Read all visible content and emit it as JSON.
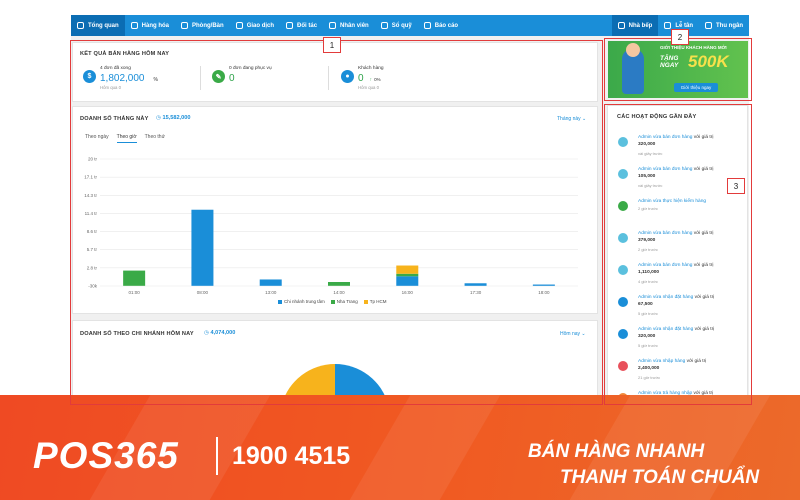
{
  "nav": {
    "left": [
      {
        "label": "Tổng quan",
        "icon": "eye-icon"
      },
      {
        "label": "Hàng hóa",
        "icon": "box-icon"
      },
      {
        "label": "Phòng/Bàn",
        "icon": "table-icon"
      },
      {
        "label": "Giao dịch",
        "icon": "exchange-icon"
      },
      {
        "label": "Đối tác",
        "icon": "handshake-icon"
      },
      {
        "label": "Nhân viên",
        "icon": "users-icon"
      },
      {
        "label": "Sổ quỹ",
        "icon": "coin-icon"
      },
      {
        "label": "Báo cáo",
        "icon": "chart-icon"
      }
    ],
    "right": [
      {
        "label": "Nhà bếp",
        "icon": "chef-hat-icon"
      },
      {
        "label": "Lễ tân",
        "icon": "calendar-icon"
      },
      {
        "label": "Thu ngân",
        "icon": "cashier-icon"
      }
    ]
  },
  "today": {
    "title": "KẾT QUẢ BÁN HÀNG HÔM NAY",
    "sold": {
      "label": "4 đơn đã xong",
      "value": "1,802,000",
      "suffix": "%",
      "sub": "Hôm qua 0"
    },
    "serving": {
      "label": "0 đơn đang phục vụ",
      "value": "0"
    },
    "customers": {
      "label": "Khách hàng",
      "value": "0",
      "change": "0%",
      "sub": "Hôm qua 0"
    }
  },
  "monthly": {
    "title": "DOANH SỐ THÁNG NÀY",
    "total": "15,582,000",
    "period": "Tháng này",
    "tabs": [
      "Theo ngày",
      "Theo giờ",
      "Theo thứ"
    ]
  },
  "chart_data": {
    "type": "bar",
    "categories": [
      "01:00",
      "08:00",
      "13:00",
      "14:00",
      "16:00",
      "17:30",
      "18:00"
    ],
    "series": [
      {
        "name": "Chi nhánh trung tâm",
        "color": "#1a8ed8",
        "values": [
          0,
          12.0,
          1.0,
          0,
          1.5,
          0.4,
          0.2
        ]
      },
      {
        "name": "Nha Trang",
        "color": "#3aaa47",
        "values": [
          2.4,
          0,
          0,
          0.6,
          0.4,
          0,
          0
        ]
      },
      {
        "name": "Tp HCM",
        "color": "#f7b31c",
        "values": [
          0,
          0,
          0,
          0,
          1.3,
          0,
          0
        ]
      }
    ],
    "yticks": [
      "20 tr",
      "17.1 tr",
      "14.3 tr",
      "11.4 tr",
      "8.6 tr",
      "5.7 tr",
      "2.8 tr",
      "-30k"
    ],
    "ylim": [
      -0.03,
      20
    ],
    "stacked": true
  },
  "branch": {
    "title": "DOANH SỐ THEO CHI NHÁNH HÔM NAY",
    "total": "4,074,000",
    "period": "Hôm nay"
  },
  "promo": {
    "line1": "GIỚI THIỆU KHÁCH HÀNG MỚI",
    "line2": "TẶNG NGAY",
    "amount": "500K",
    "button": "Giới thiệu ngay"
  },
  "activities": {
    "title": "CÁC HOẠT ĐỘNG GẦN ĐÂY",
    "items": [
      {
        "who": "Admin",
        "action": "vừa bán đơn hàng",
        "rest": "với giá trị",
        "amount": "320,000",
        "time": "vài giây trước",
        "color": "#5bc0de"
      },
      {
        "who": "Admin",
        "action": "vừa bán đơn hàng",
        "rest": "với giá trị",
        "amount": "105,000",
        "time": "vài giây trước",
        "color": "#5bc0de"
      },
      {
        "who": "Admin",
        "action": "vừa thực hiện kiểm hàng",
        "rest": "",
        "amount": "",
        "time": "2 giờ trước",
        "color": "#3aaa47"
      },
      {
        "who": "Admin",
        "action": "vừa bán đơn hàng",
        "rest": "với giá trị",
        "amount": "379,000",
        "time": "2 giờ trước",
        "color": "#5bc0de"
      },
      {
        "who": "Admin",
        "action": "vừa bán đơn hàng",
        "rest": "với giá trị",
        "amount": "1,110,000",
        "time": "4 giờ trước",
        "color": "#5bc0de"
      },
      {
        "who": "Admin",
        "action": "vừa nhận đặt hàng",
        "rest": "với giá trị",
        "amount": "67,500",
        "time": "5 giờ trước",
        "color": "#1a8ed8"
      },
      {
        "who": "Admin",
        "action": "vừa nhận đặt hàng",
        "rest": "với giá trị",
        "amount": "320,000",
        "time": "5 giờ trước",
        "color": "#1a8ed8"
      },
      {
        "who": "Admin",
        "action": "vừa nhập hàng",
        "rest": "với giá trị",
        "amount": "2,400,000",
        "time": "21 giờ trước",
        "color": "#e8505b"
      },
      {
        "who": "Admin",
        "action": "vừa trả hàng nhập",
        "rest": "với giá trị",
        "amount": "",
        "time": "",
        "color": "#f0883a"
      }
    ]
  },
  "callouts": [
    "1",
    "2",
    "3"
  ],
  "footer": {
    "brand": "POS365",
    "phone": "1900 4515",
    "slogan1": "BÁN HÀNG NHANH",
    "slogan2": "THANH TOÁN CHUẨN"
  }
}
